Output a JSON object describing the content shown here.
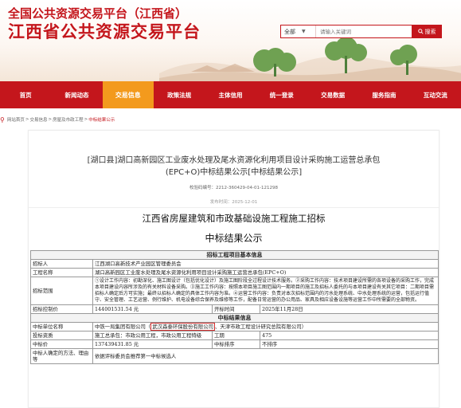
{
  "site": {
    "subtitle": "全国公共资源交易平台（江西省）",
    "title": "江西省公共资源交易平台"
  },
  "search": {
    "scope": "全部",
    "placeholder": "请输入关键词",
    "button": "搜索"
  },
  "nav": [
    {
      "label": "首页"
    },
    {
      "label": "新闻动态"
    },
    {
      "label": "交易信息",
      "active": true
    },
    {
      "label": "政策法规"
    },
    {
      "label": "主体信用"
    },
    {
      "label": "统一登录"
    },
    {
      "label": "交易数据"
    },
    {
      "label": "服务指南"
    },
    {
      "label": "互动交流"
    }
  ],
  "breadcrumb": [
    "网站首页",
    "交易信息",
    "房屋及市政工程",
    "中标结果公示"
  ],
  "article": {
    "title_line1": "[湖口县]湖口高新园区工业废水处理及尾水资源化利用项目设计采购施工运营总承包",
    "title_line2": "(EPC+O)中标结果公示[中标结果公示]",
    "verify_code": "校验码编号：2212-360429-04-01-121298",
    "publish_time": "发布时间：2025-12-01"
  },
  "document": {
    "heading": "江西省房屋建筑和市政基础设施工程施工招标",
    "subheading": "中标结果公示",
    "section1_title": "招标工程项目基本信息",
    "rows1": [
      {
        "label": "招标人",
        "value": "江西湖口高新技术产业园区管理委员会"
      },
      {
        "label": "工程名称",
        "value": "湖口高新园区工业废水处理及尾水资源化利用项目设计采购施工运营总承包(EPC+O)"
      },
      {
        "label": "招标范围",
        "value": "①设计工作内容：初勘深化、施工图设计（包括优化设计）及施工图阶段全过程设计技术服务。②采购工作内容：技术项目建设所需的各项设备的采购工作，完成本项目建设内容所涉及的有关材料设备采购。③施工工作内容：按照本项目施工图范围内一期项目的施工及招标人委托的与本项目建设有关其它项目：二期项目需招标人确定后方可实施；最终以招标人确定的具体工作内容为准。④运营工作内容：负责对本次招标范围内的污水处理系统、中水处理系统的运营，包括运行值守、安全管理、工艺运营、例行维护、机电设备综合保养及维修等工作，配备日常运营的办公用品、家具及相应设备设施等运营工作中所需要的全部物资。"
      },
      {
        "label": "招标控制价",
        "value": "144001531.54 元",
        "extra_label": "开标时间",
        "extra_value": "2025年11月28日"
      }
    ],
    "section2_title": "中标结果信息",
    "winner_label": "中标单位名称",
    "winner_part1": "中铁一局集团有限公司（",
    "winner_highlight": "武汉森泰环保股份有限公司",
    "winner_part2": "、天津市政工程设计研究总院有限公司）",
    "qual_label": "投标资质",
    "qual_value": "施工总承包：市政公用工程，市政公用工程特级",
    "period_label": "工期",
    "period_value": "475",
    "price_label": "中标价",
    "price_value": "137439431.85 元",
    "rank_label": "中标排序",
    "rank_value": "不排序",
    "method_label": "中标人确定的方法、理由等",
    "method_value": "依据评标委员会推荐第一中标候选人"
  },
  "colors": {
    "brand": "#c4161c",
    "active_nav": "#f39a1d"
  }
}
